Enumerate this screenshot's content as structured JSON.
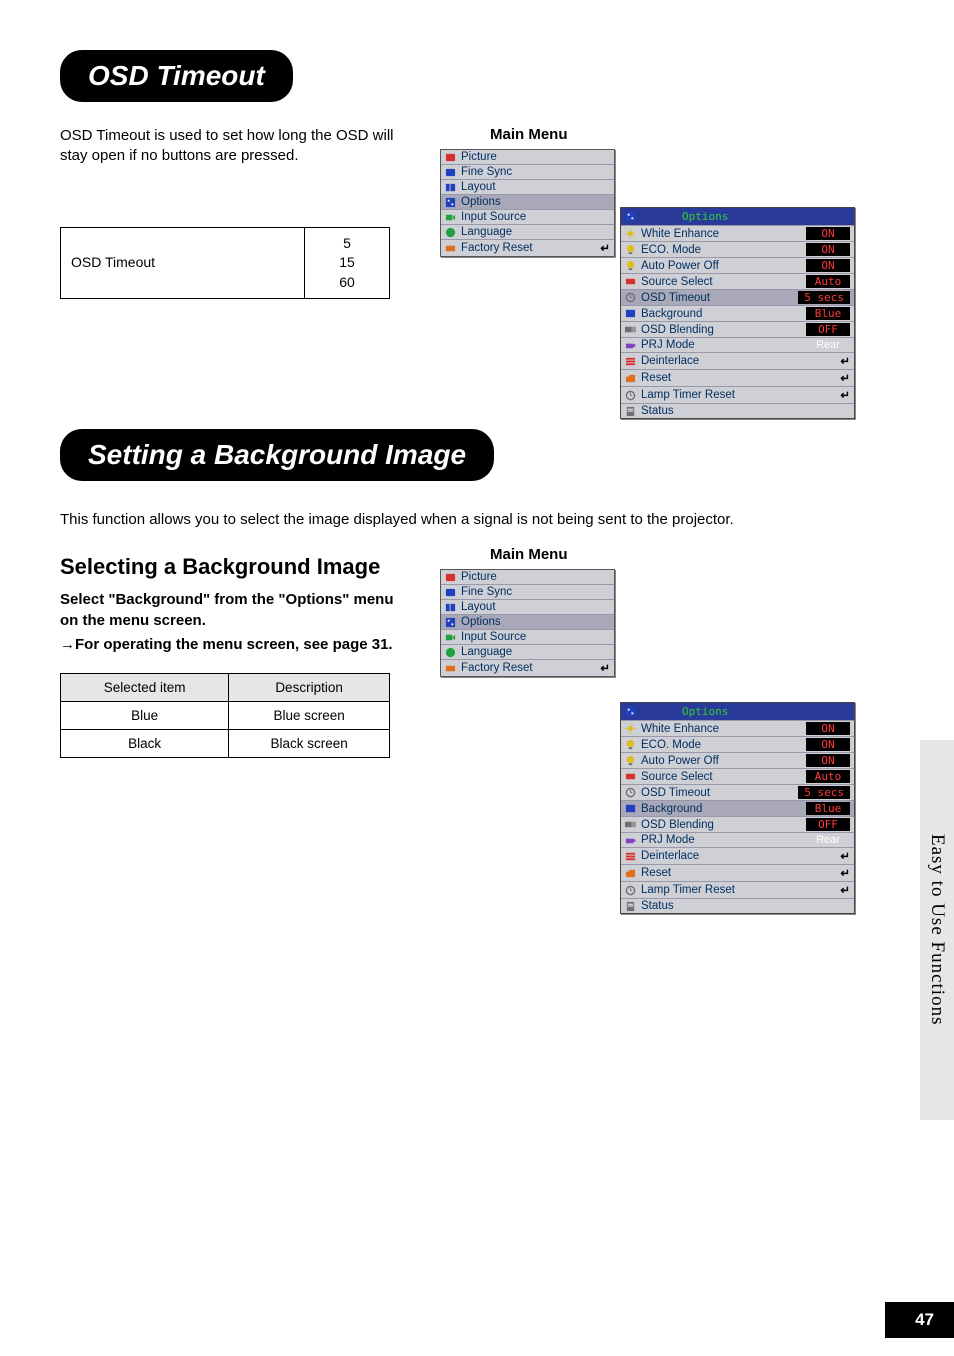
{
  "page_number": "47",
  "side_tab": "Easy to Use Functions",
  "section1": {
    "title": "OSD Timeout",
    "intro": "OSD Timeout is used to set how long the OSD will stay open if no buttons are pressed.",
    "table": {
      "label": "OSD Timeout",
      "values": [
        "5",
        "15",
        "60"
      ]
    },
    "main_menu_label": "Main Menu",
    "main_menu": {
      "items": [
        {
          "label": "Picture"
        },
        {
          "label": "Fine Sync"
        },
        {
          "label": "Layout"
        },
        {
          "label": "Options",
          "highlighted": true
        },
        {
          "label": "Input Source"
        },
        {
          "label": "Language"
        },
        {
          "label": "Factory Reset",
          "enter": true
        }
      ]
    },
    "options_menu": {
      "header": "Options",
      "items": [
        {
          "label": "White Enhance",
          "value": "ON"
        },
        {
          "label": "ECO. Mode",
          "value": "ON"
        },
        {
          "label": "Auto Power Off",
          "value": "ON"
        },
        {
          "label": "Source Select",
          "value": "Auto"
        },
        {
          "label": "OSD Timeout",
          "value": "5 secs",
          "highlighted": true
        },
        {
          "label": "Background",
          "value": "Blue"
        },
        {
          "label": "OSD Blending",
          "value": "OFF"
        },
        {
          "label": "PRJ Mode",
          "value_plain": "Rear"
        },
        {
          "label": "Deinterlace",
          "enter": true
        },
        {
          "label": "Reset",
          "enter": true
        },
        {
          "label": "Lamp Timer Reset",
          "enter": true
        },
        {
          "label": "Status"
        }
      ]
    }
  },
  "section2": {
    "title": "Setting a Background Image",
    "intro": "This function allows you to select the image displayed when a signal is not being sent to the projector.",
    "subhead": "Selecting a Background Image",
    "instruction_line1": "Select \"Background\" from the \"Options\" menu on the menu screen.",
    "instruction_line2_prefix": "→",
    "instruction_line2": "For operating the menu screen, see page 31.",
    "main_menu_label": "Main Menu",
    "main_menu": {
      "items": [
        {
          "label": "Picture"
        },
        {
          "label": "Fine Sync"
        },
        {
          "label": "Layout"
        },
        {
          "label": "Options",
          "highlighted": true
        },
        {
          "label": "Input Source"
        },
        {
          "label": "Language"
        },
        {
          "label": "Factory Reset",
          "enter": true
        }
      ]
    },
    "options_menu": {
      "header": "Options",
      "items": [
        {
          "label": "White Enhance",
          "value": "ON"
        },
        {
          "label": "ECO. Mode",
          "value": "ON"
        },
        {
          "label": "Auto Power Off",
          "value": "ON"
        },
        {
          "label": "Source Select",
          "value": "Auto"
        },
        {
          "label": "OSD Timeout",
          "value": "5 secs"
        },
        {
          "label": "Background",
          "value": "Blue",
          "highlighted": true
        },
        {
          "label": "OSD Blending",
          "value": "OFF"
        },
        {
          "label": "PRJ Mode",
          "value_plain": "Rear"
        },
        {
          "label": "Deinterlace",
          "enter": true
        },
        {
          "label": "Reset",
          "enter": true
        },
        {
          "label": "Lamp Timer Reset",
          "enter": true
        },
        {
          "label": "Status"
        }
      ]
    },
    "desc_table": {
      "headers": [
        "Selected item",
        "Description"
      ],
      "rows": [
        [
          "Blue",
          "Blue screen"
        ],
        [
          "Black",
          "Black screen"
        ]
      ]
    }
  }
}
